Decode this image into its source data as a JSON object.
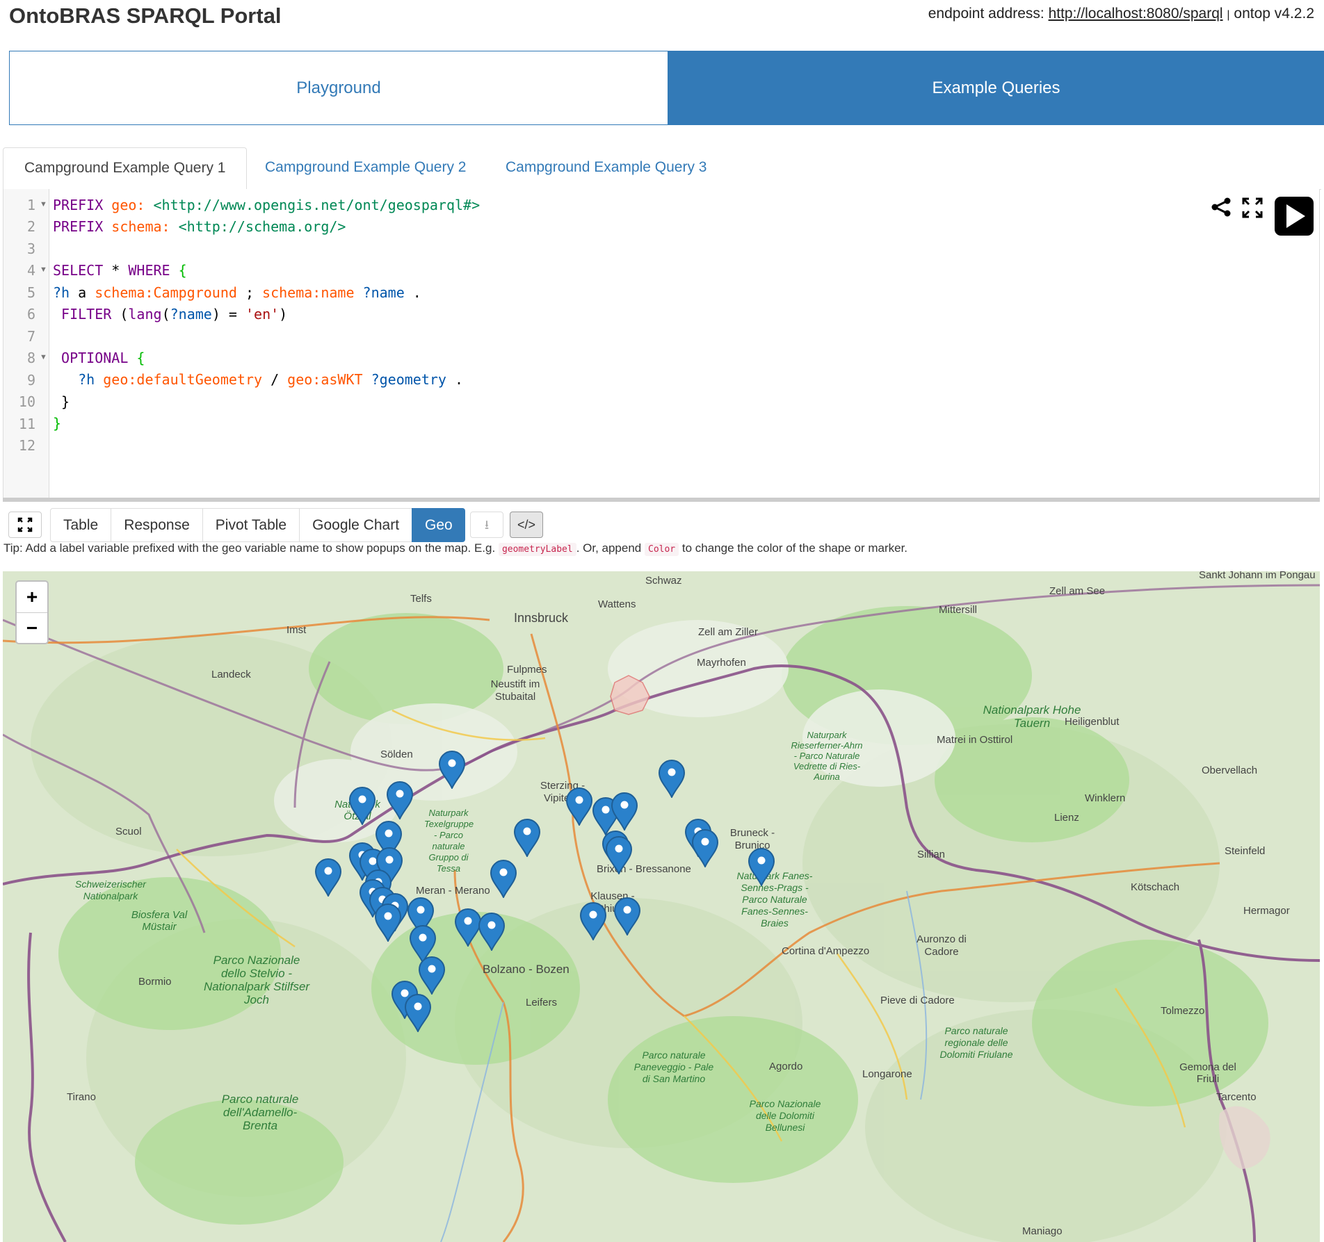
{
  "header": {
    "title": "OntoBRAS SPARQL Portal",
    "endpoint_label": "endpoint address:",
    "endpoint_url": "http://localhost:8080/sparql",
    "separator": "|",
    "version": "ontop v4.2.2"
  },
  "main_tabs": [
    {
      "label": "Playground",
      "active": false
    },
    {
      "label": "Example Queries",
      "active": true
    }
  ],
  "query_tabs": [
    {
      "label": "Campground Example Query 1",
      "active": true
    },
    {
      "label": "Campground Example Query 2",
      "active": false
    },
    {
      "label": "Campground Example Query 3",
      "active": false
    }
  ],
  "editor": {
    "line_numbers": [
      "1",
      "2",
      "3",
      "4",
      "5",
      "6",
      "7",
      "8",
      "9",
      "10",
      "11",
      "12"
    ],
    "lines": [
      "PREFIX geo: <http://www.opengis.net/ont/geosparql#>",
      "PREFIX schema: <http://schema.org/>",
      "",
      "SELECT * WHERE {",
      "?h a schema:Campground ; schema:name ?name .",
      " FILTER (lang(?name) = 'en')",
      "",
      " OPTIONAL {",
      "   ?h geo:defaultGeometry / geo:asWKT ?geometry .",
      " }",
      "}",
      ""
    ],
    "icons": [
      "share-icon",
      "fullscreen-icon",
      "run-query-icon"
    ]
  },
  "result_tabs": [
    {
      "label": "Table",
      "active": false
    },
    {
      "label": "Response",
      "active": false
    },
    {
      "label": "Pivot Table",
      "active": false
    },
    {
      "label": "Google Chart",
      "active": false
    },
    {
      "label": "Geo",
      "active": true
    }
  ],
  "result_buttons": {
    "code_label": "</>"
  },
  "tip": {
    "prefix": "Tip: Add a label variable prefixed with the geo variable name to show popups on the map. E.g.",
    "code1": "geometryLabel",
    "middle": ". Or, append",
    "code2": "Color",
    "suffix": "to change the color of the shape or marker."
  },
  "map": {
    "zoom_in": "+",
    "zoom_out": "−",
    "places": [
      "Schwaz",
      "Telfs",
      "Wattens",
      "Innsbruck",
      "Imst",
      "Zell am Ziller",
      "Mittersill",
      "Zell am See",
      "Sankt Johann im Pongau",
      "Landeck",
      "Fulpmes",
      "Neustift im Stubaital",
      "Mayrhofen",
      "Heiligenblut",
      "Matrei in Osttirol",
      "Sölden",
      "Obervellach",
      "Winklern",
      "Lienz",
      "Steinfeld",
      "Scuol",
      "Sillian",
      "Kötschach",
      "Hermagor",
      "Meran - Merano",
      "Brixen - Bressanone",
      "Klausen - Chiusa",
      "Bormio",
      "Cortina d'Ampezzo",
      "Auronzo di Cadore",
      "Bolzano - Bozen",
      "Leifers",
      "Pieve di Cadore",
      "Tolmezzo",
      "Agordo",
      "Longarone",
      "Gemona del Friuli",
      "Tirano",
      "Maniago",
      "Tarcento",
      "Sterzing - Vipiteno",
      "Bruneck - Brunico"
    ],
    "parks": [
      "Nationalpark Hohe Tauern",
      "Naturpark Rieserferner-Ahrn - Parco Naturale Vedrette di Ries-Aurina",
      "Naturpark Ötztal",
      "Schweizerischer Nationalpark",
      "Biosfera Val Müstair",
      "Parco Nazionale dello Stelvio - Nationalpark Stilfser Joch",
      "Naturpark Fanes-Sennes-Prags - Parco Naturale Fanes-Sennes-Braies",
      "Parco naturale Paneveggio - Pale di San Martino",
      "Parco Nazionale delle Dolomiti Bellunesi",
      "Parco naturale regionale delle Dolomiti Friulane",
      "Parco naturale dell'Adamello-Brenta",
      "Naturpark Texelgruppe - Parco naturale Gruppo di Tessa"
    ]
  }
}
